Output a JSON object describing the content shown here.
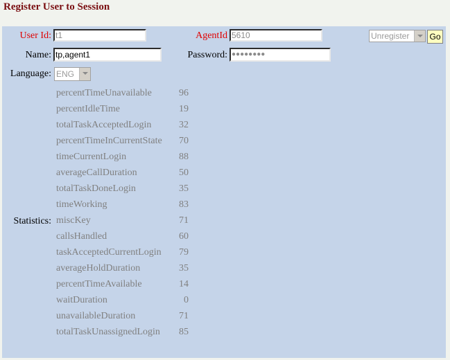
{
  "page_title": "Register User to Session",
  "form": {
    "user_id_label": "User Id:",
    "user_id_value": "t1",
    "agent_id_label": "AgentId",
    "agent_id_value": "5610",
    "action_select_value": "Unregister",
    "go_button": "Go",
    "name_label": "Name:",
    "name_value": "tp,agent1",
    "password_label": "Password:",
    "password_value": "●●●●●●●●",
    "language_label": "Language:",
    "language_value": "ENG",
    "statistics_label": "Statistics:"
  },
  "colors": {
    "title": "#7a0f12",
    "panel_bg": "#c5d4e9",
    "required_label": "#e00000",
    "go_button_bg": "#ffffc0"
  },
  "statistics": [
    {
      "name": "percentTimeUnavailable",
      "value": "96"
    },
    {
      "name": "percentIdleTime",
      "value": "19"
    },
    {
      "name": "totalTaskAcceptedLogin",
      "value": "32"
    },
    {
      "name": "percentTimeInCurrentState",
      "value": "70"
    },
    {
      "name": "timeCurrentLogin",
      "value": "88"
    },
    {
      "name": "averageCallDuration",
      "value": "50"
    },
    {
      "name": "totalTaskDoneLogin",
      "value": "35"
    },
    {
      "name": "timeWorking",
      "value": "83"
    },
    {
      "name": "miscKey",
      "value": "71"
    },
    {
      "name": "callsHandled",
      "value": "60"
    },
    {
      "name": "taskAcceptedCurrentLogin",
      "value": "79"
    },
    {
      "name": "averageHoldDuration",
      "value": "35"
    },
    {
      "name": "percentTimeAvailable",
      "value": "14"
    },
    {
      "name": "waitDuration",
      "value": "0"
    },
    {
      "name": "unavailableDuration",
      "value": "71"
    },
    {
      "name": "totalTaskUnassignedLogin",
      "value": "85"
    }
  ]
}
